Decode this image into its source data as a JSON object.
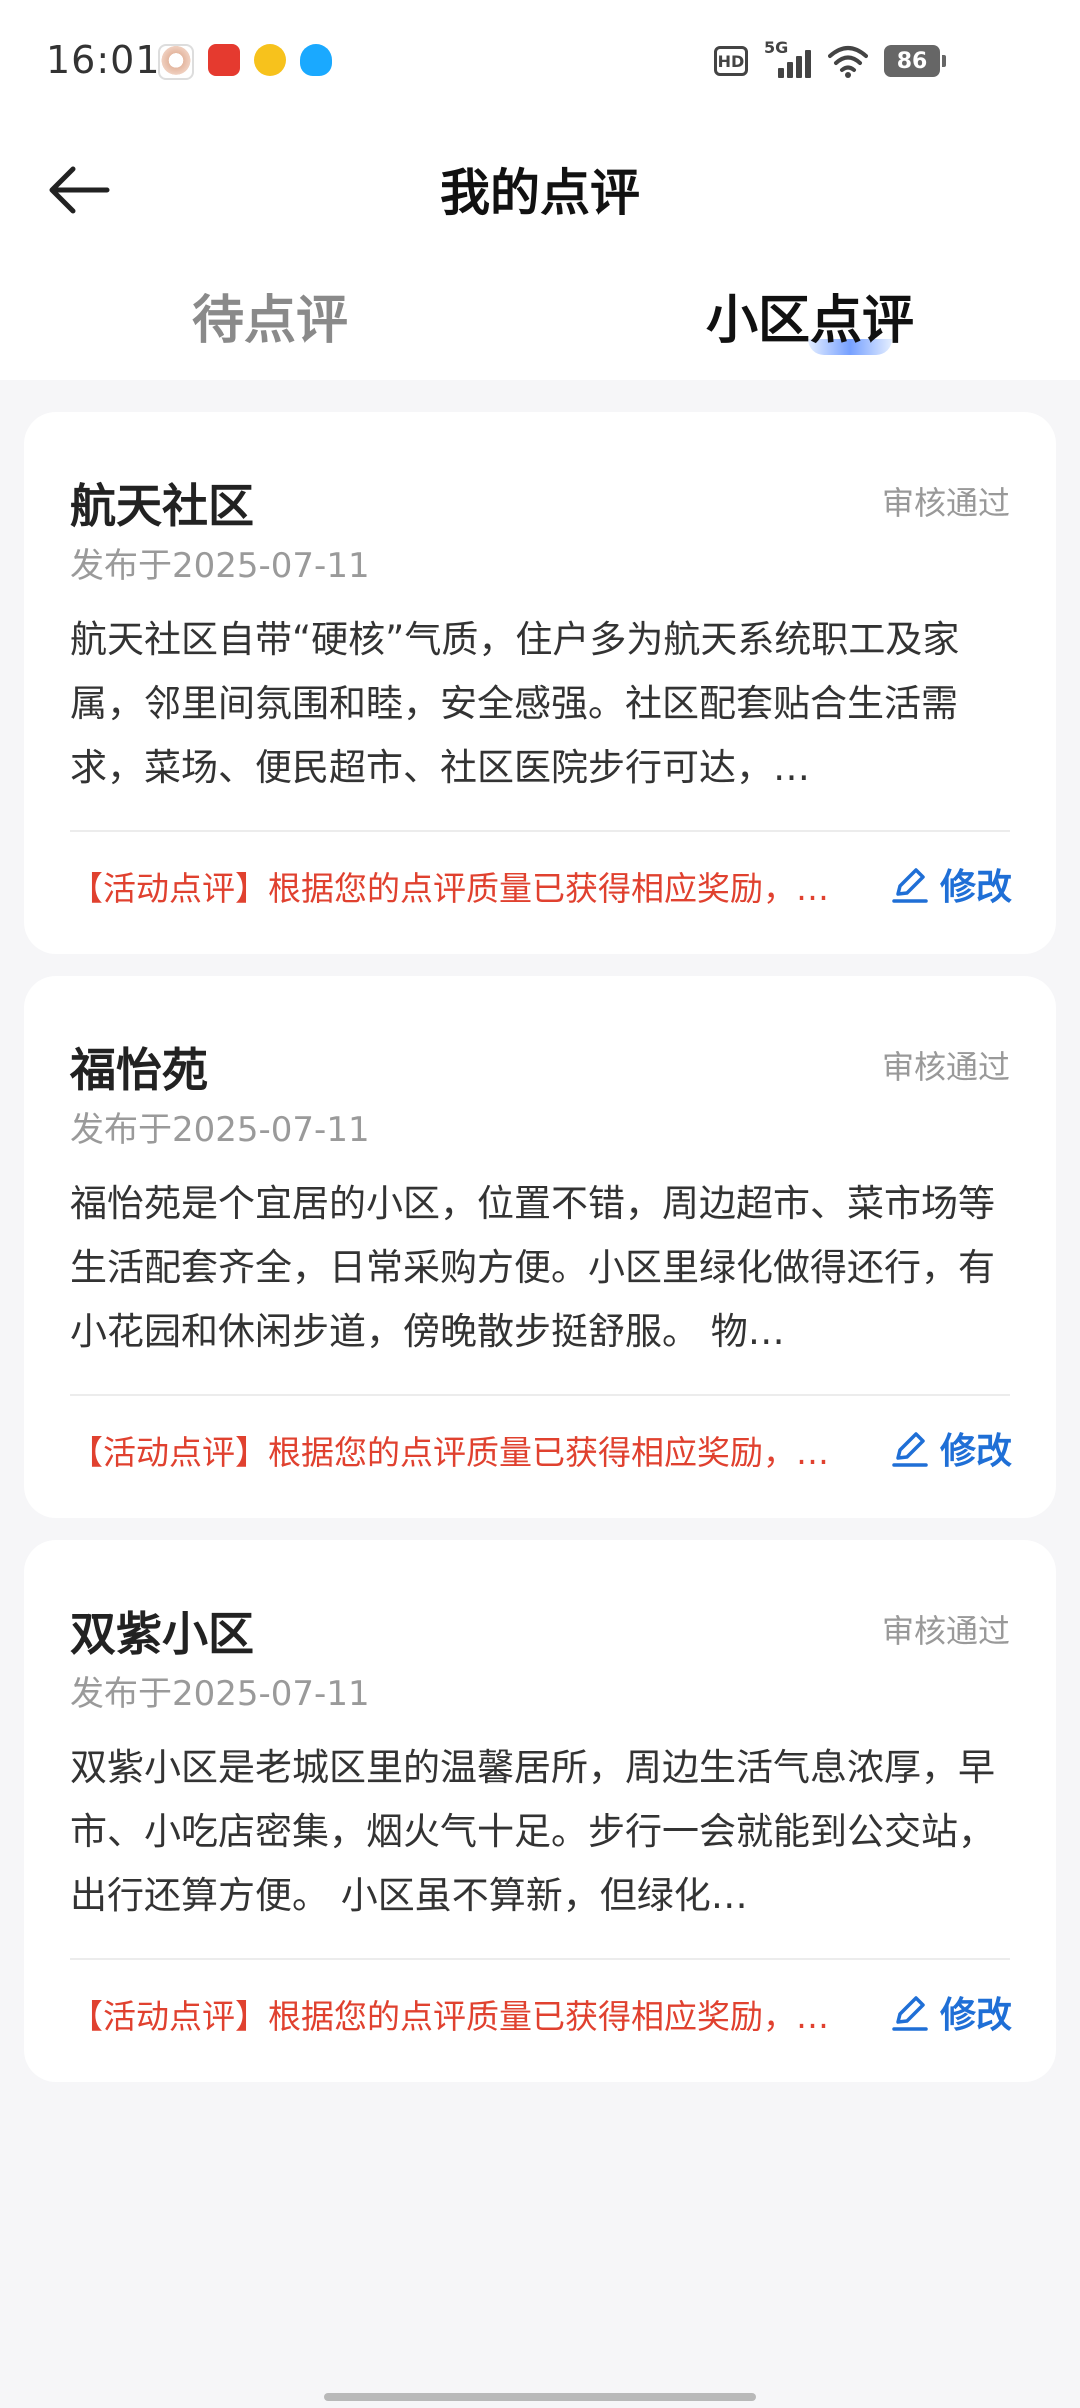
{
  "status_bar": {
    "time": "16:01",
    "apps": [
      "avatar-app-icon",
      "red-app-icon",
      "coin-app-icon",
      "qq-penguin-icon"
    ],
    "hd_label": "HD",
    "network": "5G",
    "battery": "86"
  },
  "header": {
    "title": "我的点评",
    "tabs": [
      {
        "label": "待点评",
        "active": false
      },
      {
        "label": "小区点评",
        "active": true
      }
    ]
  },
  "colors": {
    "reward_red": "#e0412f",
    "edit_blue": "#1f6fd6",
    "background": "#f6f6f8"
  },
  "reviews": [
    {
      "title": "航天社区",
      "status": "审核通过",
      "date": "发布于2025-07-11",
      "body": "航天社区自带“硬核”气质，住户多为航天系统职工及家属，邻里间氛围和睦，安全感强。社区配套贴合生活需求，菜场、便民超市、社区医院步行可达，…",
      "reward": "【活动点评】根据您的点评质量已获得相应奖励，…",
      "edit_label": "修改"
    },
    {
      "title": "福怡苑",
      "status": "审核通过",
      "date": "发布于2025-07-11",
      "body": "福怡苑是个宜居的小区，位置不错，周边超市、菜市场等生活配套齐全，日常采购方便。小区里绿化做得还行，有小花园和休闲步道，傍晚散步挺舒服。 物…",
      "reward": "【活动点评】根据您的点评质量已获得相应奖励，…",
      "edit_label": "修改"
    },
    {
      "title": "双紫小区",
      "status": "审核通过",
      "date": "发布于2025-07-11",
      "body": "双紫小区是老城区里的温馨居所，周边生活气息浓厚，早市、小吃店密集，烟火气十足。步行一会就能到公交站，出行还算方便。 小区虽不算新，但绿化…",
      "reward": "【活动点评】根据您的点评质量已获得相应奖励，…",
      "edit_label": "修改"
    }
  ]
}
